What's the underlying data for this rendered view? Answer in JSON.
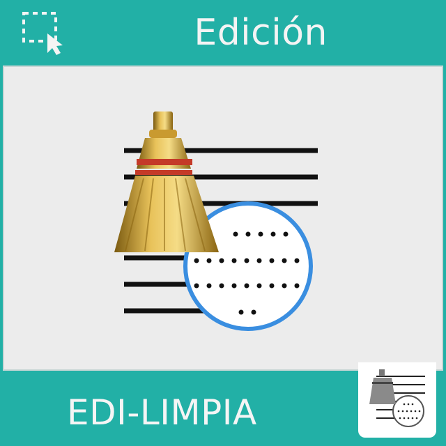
{
  "header": {
    "title": "Edición",
    "icon": "selection-cursor-icon"
  },
  "main": {
    "icon": "broom-clean-document-icon"
  },
  "footer": {
    "code": "EDI-LIMPIA",
    "thumbnail_icon": "broom-clean-document-icon"
  },
  "colors": {
    "teal": "#22b0a6",
    "panel": "#ececec",
    "circle_border": "#3a8ee0"
  }
}
